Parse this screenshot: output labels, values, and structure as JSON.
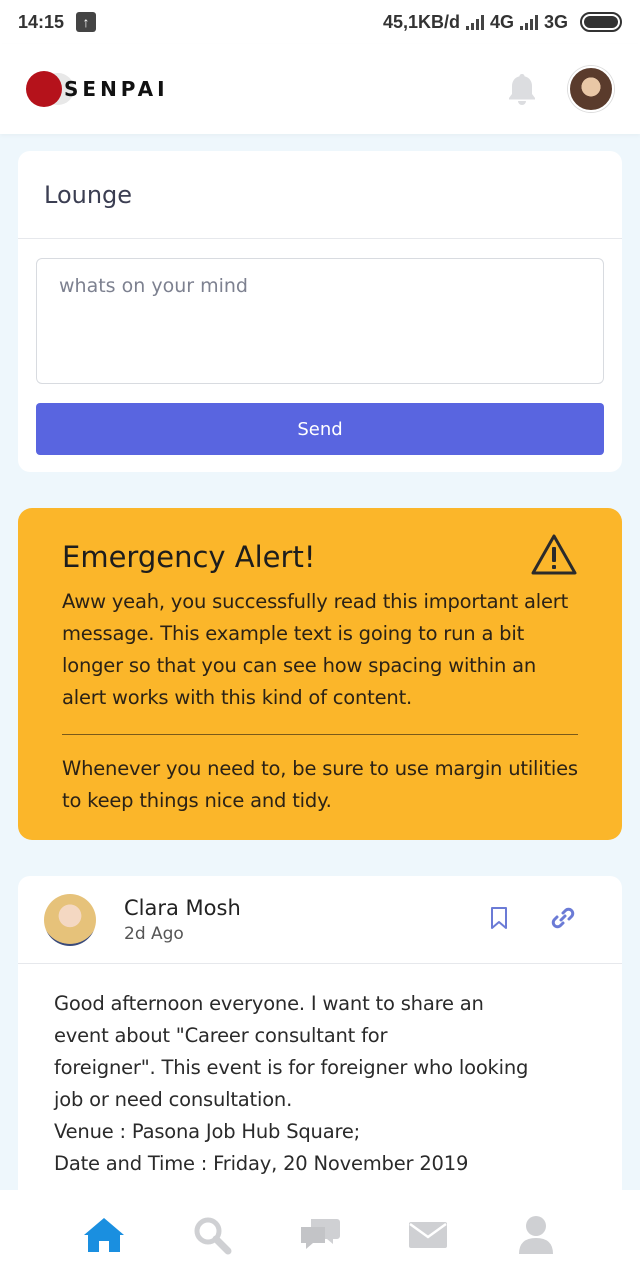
{
  "status_bar": {
    "time": "14:15",
    "network_speed": "45,1KB/d",
    "network_1": "4G",
    "network_2": "3G"
  },
  "app": {
    "logo_text": "SENPAI",
    "brand_color": "#b5121b",
    "accent_color": "#5965e0",
    "alert_color": "#fbb62a"
  },
  "lounge": {
    "title": "Lounge",
    "placeholder": "whats on your mind",
    "send_label": "Send"
  },
  "alert": {
    "title": "Emergency Alert!",
    "paragraph1": "Aww yeah, you successfully read this important alert message. This example text is going to run a bit longer so that you can see how spacing within an alert works with this kind of content.",
    "paragraph2": "Whenever you need to, be sure to use margin utilities to keep things nice and tidy."
  },
  "post": {
    "author": "Clara Mosh",
    "time": "2d Ago",
    "lines": [
      "Good afternoon everyone. I want to share an",
      "event about \"Career consultant for",
      "foreigner\". This event is for foreigner who looking",
      "job or need consultation.",
      "Venue : Pasona Job Hub Square;",
      "Date and Time : Friday, 20 November 2019"
    ]
  },
  "bottom_nav": [
    {
      "icon": "home-icon",
      "active": true
    },
    {
      "icon": "search-icon",
      "active": false
    },
    {
      "icon": "chat-icon",
      "active": false
    },
    {
      "icon": "mail-icon",
      "active": false
    },
    {
      "icon": "user-icon",
      "active": false
    }
  ]
}
